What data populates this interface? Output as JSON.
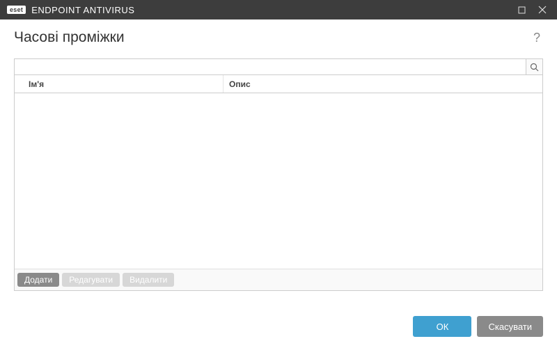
{
  "titlebar": {
    "logo": "eset",
    "app_title": "ENDPOINT ANTIVIRUS"
  },
  "page": {
    "title": "Часові проміжки"
  },
  "search": {
    "value": "",
    "placeholder": ""
  },
  "table": {
    "columns": {
      "name": "Ім'я",
      "description": "Опис"
    },
    "rows": []
  },
  "actions": {
    "add": "Додати",
    "edit": "Редагувати",
    "delete": "Видалити"
  },
  "footer": {
    "ok": "ОК",
    "cancel": "Скасувати"
  },
  "colors": {
    "titlebar_bg": "#3d3d3d",
    "primary_btn": "#3fa0d0",
    "secondary_btn": "#8a8a8a",
    "disabled_btn": "#d7d7d7"
  }
}
